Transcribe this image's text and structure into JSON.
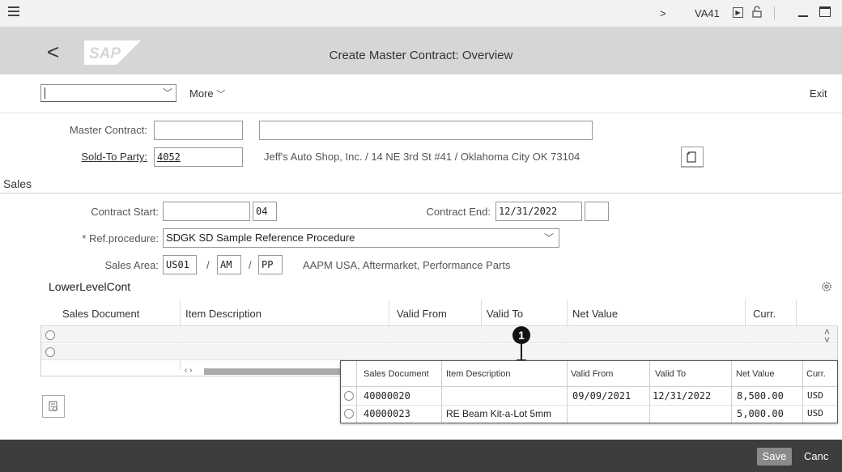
{
  "system_bar": {
    "nav_arrow": ">",
    "transaction": "VA41"
  },
  "header": {
    "back": "<",
    "logo_text": "SAP",
    "title": "Create Master Contract: Overview"
  },
  "toolbar": {
    "command_field_value": "",
    "more_label": "More",
    "exit_label": "Exit"
  },
  "master_contract": {
    "label": "Master Contract:",
    "value": "",
    "description": ""
  },
  "sold_to": {
    "label": "Sold-To Party:",
    "value": "4052",
    "address": "Jeff's Auto Shop, Inc. / 14 NE 3rd St #41 / Oklahoma City OK 73104"
  },
  "tabs": {
    "sales": "Sales"
  },
  "sales": {
    "contract_start_label": "Contract Start:",
    "contract_start_value": "",
    "contract_start_suffix": "04",
    "contract_end_label": "Contract End:",
    "contract_end_value": "12/31/2022",
    "ref_procedure_label": "* Ref.procedure:",
    "ref_procedure_value": "SDGK SD Sample Reference Procedure",
    "sales_area_label": "Sales Area:",
    "sales_org": "US01",
    "distribution_channel": "AM",
    "division": "PP",
    "sales_area_description": "AAPM USA, Aftermarket, Performance Parts",
    "slash": "/"
  },
  "lower_level": {
    "section_title": "LowerLevelCont",
    "columns": [
      "Sales Document",
      "Item Description",
      "Valid From",
      "Valid To",
      "Net Value",
      "Curr."
    ]
  },
  "popup": {
    "callout": "1",
    "columns": [
      "Sales Document",
      "Item Description",
      "Valid From",
      "Valid To",
      "Net Value",
      "Curr."
    ],
    "rows": [
      {
        "doc": "40000020",
        "desc": "",
        "from": "09/09/2021",
        "to": "12/31/2022",
        "net": "8,500.00",
        "curr": "USD"
      },
      {
        "doc": "40000023",
        "desc": "RE Beam Kit-a-Lot 5mm",
        "from": "",
        "to": "",
        "net": "5,000.00",
        "curr": "USD"
      }
    ]
  },
  "footer": {
    "save": "Save",
    "cancel": "Canc"
  },
  "colors": {
    "shell": "#d6d6d6",
    "footer": "#3d3d3d",
    "save_button": "#8a8a8a"
  }
}
